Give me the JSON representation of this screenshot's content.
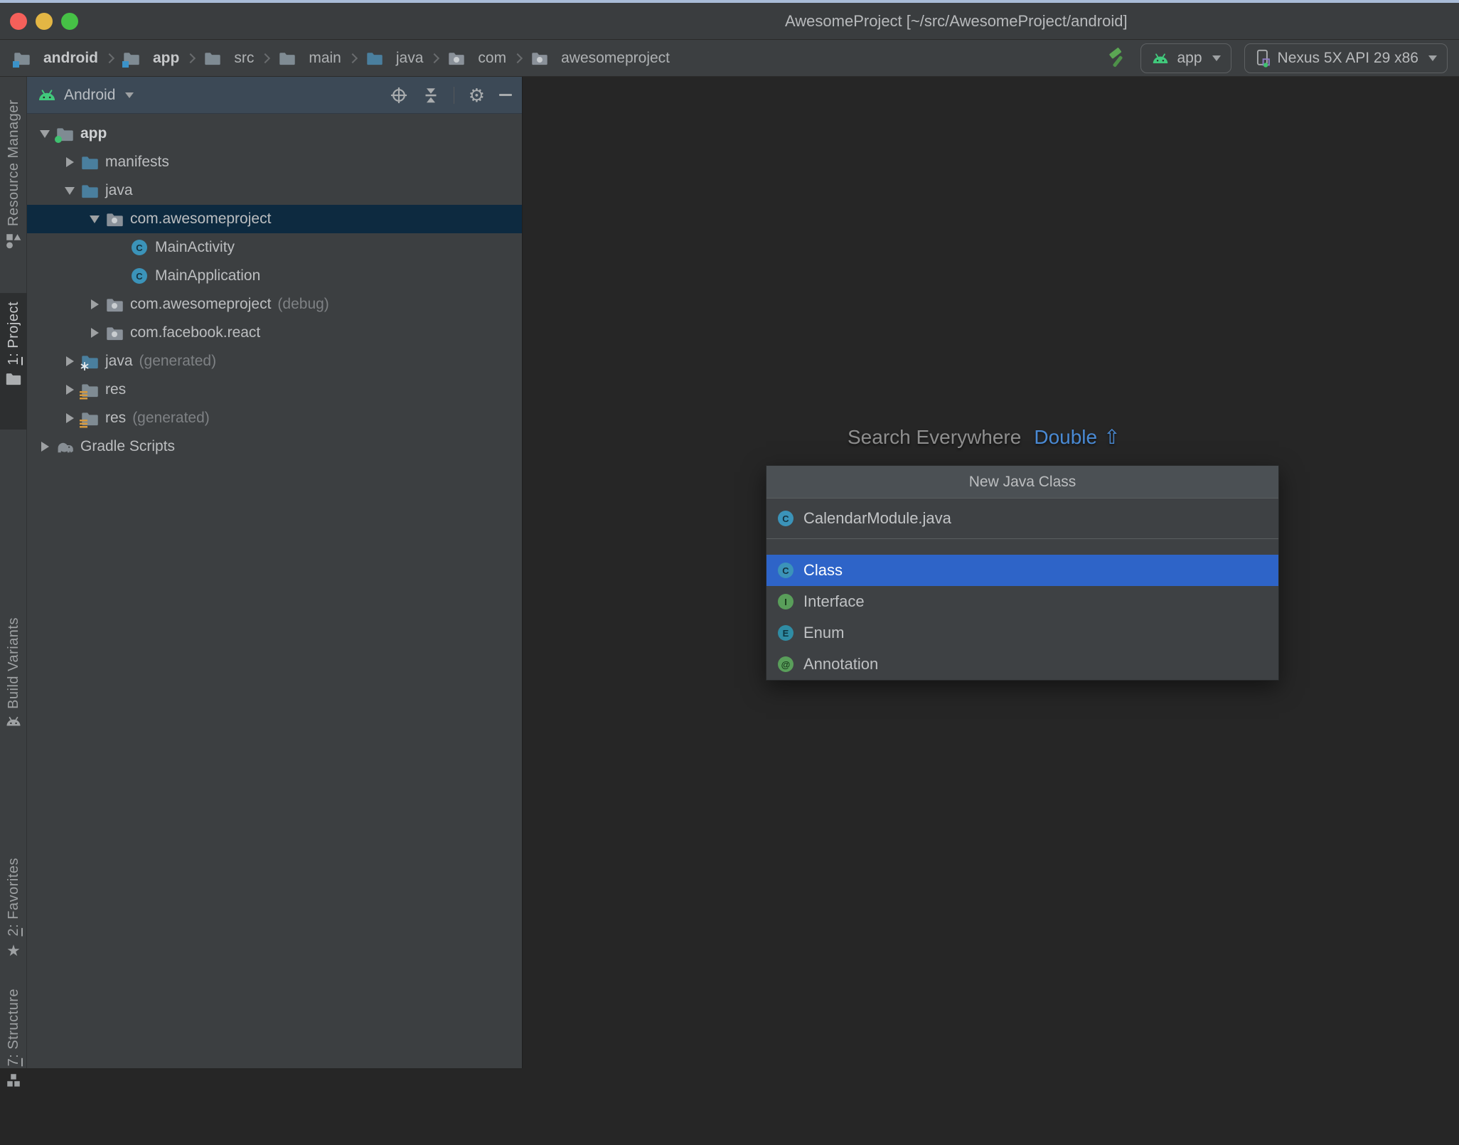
{
  "window": {
    "title": "AwesomeProject [~/src/AwesomeProject/android]"
  },
  "breadcrumbs": {
    "items": [
      {
        "label": "android"
      },
      {
        "label": "app"
      },
      {
        "label": "src"
      },
      {
        "label": "main"
      },
      {
        "label": "java"
      },
      {
        "label": "com"
      },
      {
        "label": "awesomeproject"
      }
    ]
  },
  "toolbar": {
    "config_label": "app",
    "device_label": "Nexus 5X API 29 x86"
  },
  "sidebar": {
    "tabs": [
      {
        "mnemonic": "",
        "label": "Resource Manager"
      },
      {
        "mnemonic": "1",
        "label": ": Project",
        "active": true
      },
      {
        "mnemonic": "",
        "label": "Build Variants"
      },
      {
        "mnemonic": "2",
        "label": ": Favorites"
      },
      {
        "mnemonic": "7",
        "label": ": Structure"
      }
    ]
  },
  "project_panel": {
    "view_label": "Android",
    "tree": [
      {
        "label": "app"
      },
      {
        "label": "manifests"
      },
      {
        "label": "java"
      },
      {
        "label": "com.awesomeproject"
      },
      {
        "label": "MainActivity"
      },
      {
        "label": "MainApplication"
      },
      {
        "label": "com.awesomeproject",
        "annotation": "(debug)"
      },
      {
        "label": "com.facebook.react"
      },
      {
        "label": "java",
        "annotation": "(generated)"
      },
      {
        "label": "res"
      },
      {
        "label": "res",
        "annotation": "(generated)"
      },
      {
        "label": "Gradle Scripts"
      }
    ]
  },
  "editor": {
    "hint_text": "Search Everywhere",
    "hint_shortcut": "Double",
    "hint_symbol": "⇧"
  },
  "popup": {
    "title": "New Java Class",
    "query": "CalendarModule.java",
    "items": [
      {
        "label": "Class",
        "letter": "C",
        "selected": true
      },
      {
        "label": "Interface",
        "letter": "I"
      },
      {
        "label": "Enum",
        "letter": "E"
      },
      {
        "label": "Annotation",
        "letter": "@"
      }
    ]
  },
  "icons": {
    "gear": "⚙",
    "star": "★",
    "class_letter": "C"
  },
  "colors": {
    "selection_blue": "#2E64C8",
    "tree_selection": "#0D2A40",
    "android_green": "#41C97C",
    "link_blue": "#4A8AD4",
    "panel_header": "#3C4956",
    "panel_bg": "#3C3F41",
    "editor_bg": "#262626"
  }
}
